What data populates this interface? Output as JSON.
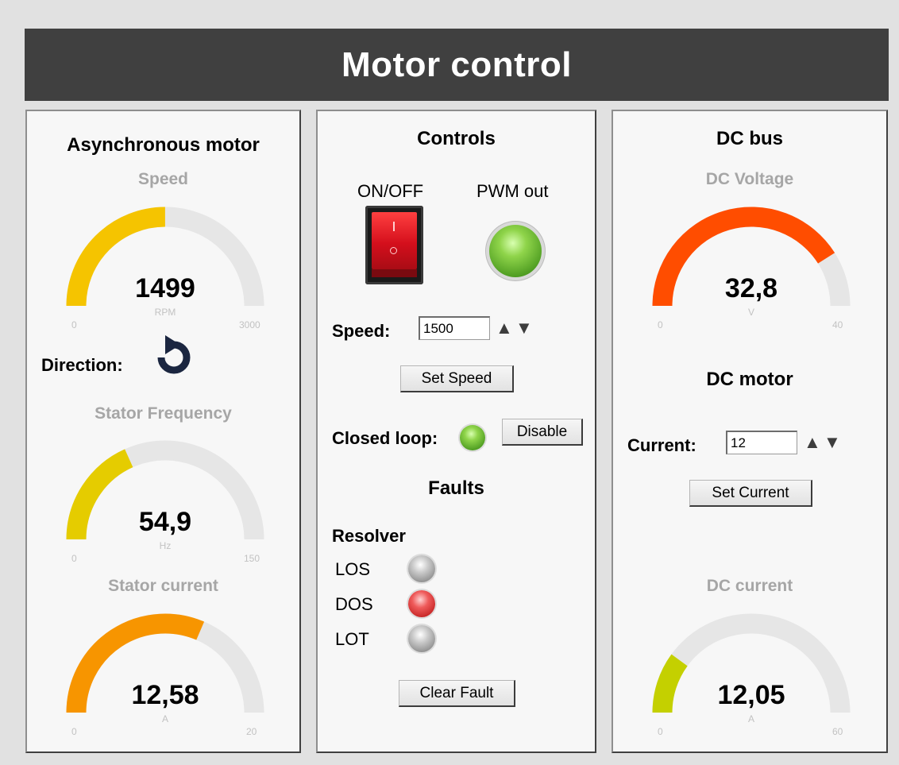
{
  "header": {
    "title": "Motor control"
  },
  "async_motor": {
    "title": "Asynchronous motor",
    "speed": {
      "title": "Speed",
      "value": "1499",
      "unit": "RPM",
      "min": "0",
      "max": "3000",
      "fraction": 0.4997,
      "color": "#f5c400"
    },
    "direction": {
      "label": "Direction:",
      "icon": "rotate-ccw-icon"
    },
    "stator_frequency": {
      "title": "Stator Frequency",
      "value": "54,9",
      "unit": "Hz",
      "min": "0",
      "max": "150",
      "fraction": 0.366,
      "color": "#e5cc00"
    },
    "stator_current": {
      "title": "Stator current",
      "value": "12,58",
      "unit": "A",
      "min": "0",
      "max": "20",
      "fraction": 0.629,
      "color": "#f79500"
    }
  },
  "controls": {
    "title": "Controls",
    "on_off_label": "ON/OFF",
    "pwm_label": "PWM out",
    "speed_label": "Speed:",
    "speed_value": "1500",
    "set_speed": "Set Speed",
    "closed_loop_label": "Closed loop:",
    "disable": "Disable",
    "faults_title": "Faults",
    "resolver_label": "Resolver",
    "faults": [
      {
        "label": "LOS",
        "state": "off"
      },
      {
        "label": "DOS",
        "state": "active"
      },
      {
        "label": "LOT",
        "state": "off"
      }
    ],
    "clear_fault": "Clear Fault"
  },
  "dc_bus": {
    "title": "DC bus",
    "voltage": {
      "title": "DC Voltage",
      "value": "32,8",
      "unit": "V",
      "min": "0",
      "max": "40",
      "fraction": 0.82,
      "color": "#ff4d00"
    }
  },
  "dc_motor": {
    "title": "DC motor",
    "current_label": "Current:",
    "current_value": "12",
    "set_current": "Set Current",
    "dc_current": {
      "title": "DC current",
      "value": "12,05",
      "unit": "A",
      "min": "0",
      "max": "60",
      "fraction": 0.2008,
      "color": "#c4d000"
    }
  }
}
